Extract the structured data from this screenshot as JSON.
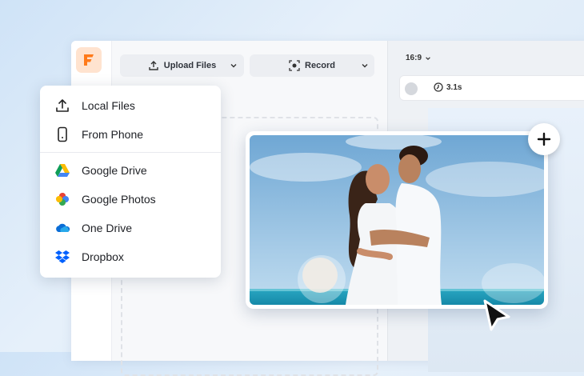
{
  "toolbar": {
    "upload_label": "Upload Files",
    "record_label": "Record"
  },
  "canvas": {
    "aspect_ratio": "16:9",
    "duration": "3.1s"
  },
  "menu": {
    "items": [
      {
        "label": "Local Files",
        "icon": "upload-icon"
      },
      {
        "label": "From Phone",
        "icon": "phone-icon"
      },
      {
        "label": "Google Drive",
        "icon": "google-drive-icon"
      },
      {
        "label": "Google Photos",
        "icon": "google-photos-icon"
      },
      {
        "label": "One Drive",
        "icon": "onedrive-icon"
      },
      {
        "label": "Dropbox",
        "icon": "dropbox-icon"
      }
    ]
  },
  "colors": {
    "brand_orange": "#ff7a1a",
    "logo_bg": "#ffe3cf",
    "dropbox_blue": "#0061fe",
    "onedrive_blue": "#0a6dd6"
  }
}
